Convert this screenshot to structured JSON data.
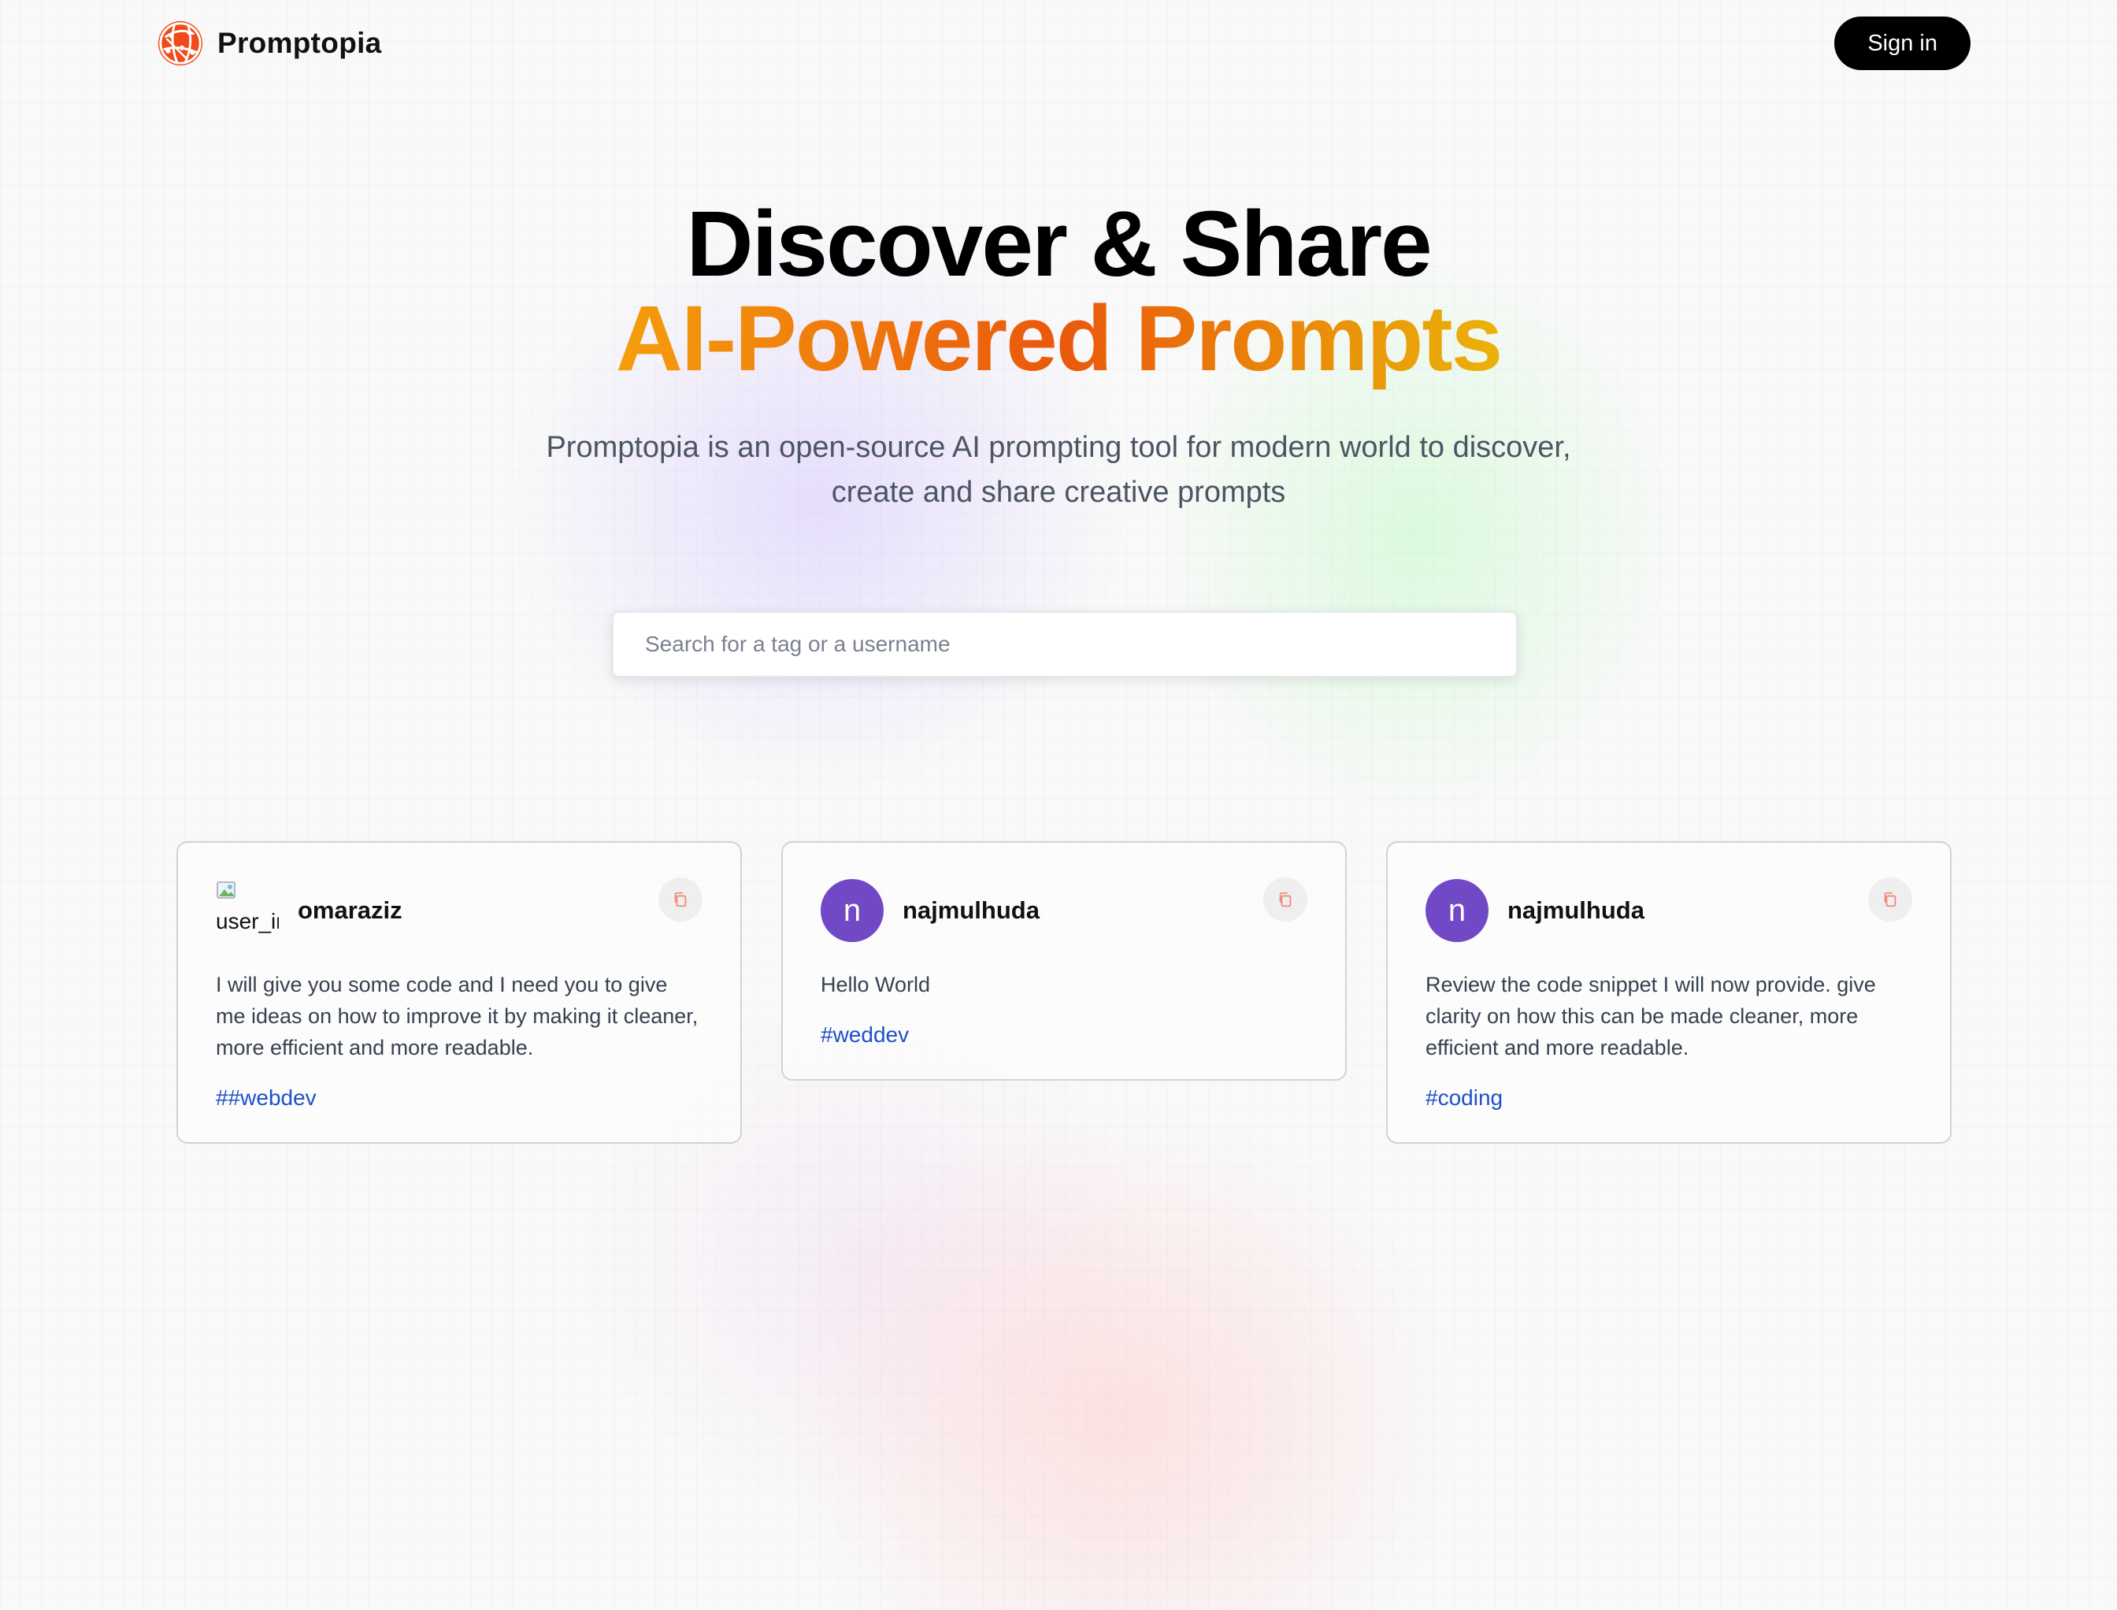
{
  "nav": {
    "brand_name": "Promptopia",
    "logo_icon": "globe-network-icon",
    "sign_in_label": "Sign in"
  },
  "hero": {
    "headline_line1": "Discover & Share",
    "headline_line2": "AI-Powered Prompts",
    "description": "Promptopia is an open-source AI prompting tool for modern world to discover, create and share creative prompts"
  },
  "search": {
    "placeholder": "Search for a tag or a username",
    "value": ""
  },
  "colors": {
    "brand_orange": "#ea580c",
    "gradient_start": "#f59e0b",
    "gradient_end": "#eab308",
    "avatar_purple": "#7149c6",
    "tag_blue": "#2050c8"
  },
  "prompts": [
    {
      "username": "omaraziz",
      "avatar_initial": "",
      "avatar_alt": "user_image",
      "text": "I will give you some code and I need you to give me ideas on how to improve it by making it cleaner, more efficient and more readable.",
      "tag": "##webdev",
      "copy_icon": "copy-icon"
    },
    {
      "username": "najmulhuda",
      "avatar_initial": "n",
      "text": "Hello World",
      "tag": "#weddev",
      "copy_icon": "copy-icon"
    },
    {
      "username": "najmulhuda",
      "avatar_initial": "n",
      "text": "Review the code snippet I will now provide. give clarity on how this can be made cleaner, more efficient and more readable.",
      "tag": "#coding",
      "copy_icon": "copy-icon"
    }
  ]
}
